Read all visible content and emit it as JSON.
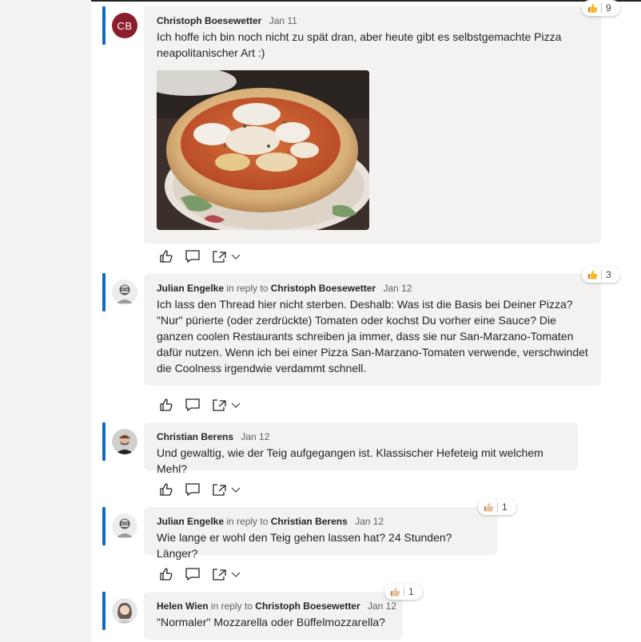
{
  "messages": [
    {
      "author": "Christoph Boesewetter",
      "avatar_initials": "CB",
      "reply_prefix": "",
      "reply_to": "",
      "date": "Jan 11",
      "text": "Ich hoffe ich bin noch nicht zu spät dran, aber heute gibt es selbstgemachte Pizza neapolitanischer Art :)",
      "reaction_count": "9",
      "has_image": true
    },
    {
      "author": "Julian Engelke",
      "reply_prefix": "in reply to",
      "reply_to": "Christoph Boesewetter",
      "date": "Jan 12",
      "text": "Ich lass den Thread hier nicht sterben. Deshalb: Was ist die Basis bei Deiner Pizza? \"Nur\" pürierte (oder zerdrückte) Tomaten oder kochst Du vorher eine Sauce? Die ganzen coolen Restaurants schreiben ja immer, dass sie nur San-Marzano-Tomaten dafür nutzen. Wenn ich bei einer Pizza San-Marzano-Tomaten verwende, verschwindet die Coolness irgendwie verdammt schnell.",
      "reaction_count": "3"
    },
    {
      "author": "Christian Berens",
      "reply_prefix": "",
      "reply_to": "",
      "date": "Jan 12",
      "text": "Und gewaltig, wie der Teig aufgegangen ist. Klassischer Hefeteig mit welchem Mehl?"
    },
    {
      "author": "Julian Engelke",
      "reply_prefix": "in reply to",
      "reply_to": "Christian Berens",
      "date": "Jan 12",
      "text": "Wie lange er wohl den Teig gehen lassen hat? 24 Stunden? Länger?",
      "reaction_count": "1"
    },
    {
      "author": "Helen Wien",
      "reply_prefix": "in reply to",
      "reply_to": "Christoph Boesewetter",
      "date": "Jan 12",
      "text": "\"Normaler\" Mozzarella oder Büffelmozzarella?",
      "reaction_count": "1"
    }
  ],
  "icons": {
    "like": "thumbs-up-outline-icon",
    "reply": "comment-icon",
    "share": "share-icon",
    "more": "chevron-down-icon",
    "reaction": "thumbs-up-emoji-icon"
  },
  "colors": {
    "accent": "#0f6cbd",
    "bubble": "#f3f2f1",
    "avatar_cb": "#8b1d2c"
  }
}
